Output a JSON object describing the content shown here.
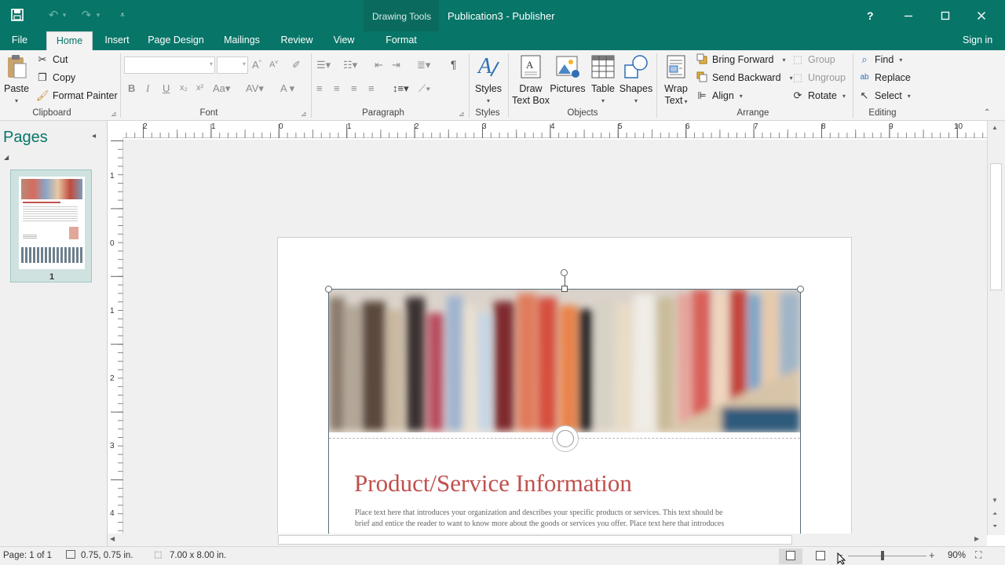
{
  "app": {
    "context_label": "Drawing Tools",
    "title": "Publication3 - Publisher",
    "help": "?",
    "sign_in": "Sign in"
  },
  "tabs": [
    "File",
    "Home",
    "Insert",
    "Page Design",
    "Mailings",
    "Review",
    "View",
    "Format"
  ],
  "active_tab": "Home",
  "ribbon": {
    "clipboard": {
      "paste": "Paste",
      "cut": "Cut",
      "copy": "Copy",
      "format_painter": "Format Painter",
      "label": "Clipboard"
    },
    "font": {
      "label": "Font",
      "font_name": "",
      "font_size": ""
    },
    "paragraph": {
      "label": "Paragraph"
    },
    "styles": {
      "styles": "Styles",
      "label": "Styles"
    },
    "objects": {
      "draw_text_box_1": "Draw",
      "draw_text_box_2": "Text Box",
      "pictures": "Pictures",
      "table": "Table",
      "shapes": "Shapes",
      "label": "Objects"
    },
    "arrange": {
      "wrap_text_1": "Wrap",
      "wrap_text_2": "Text",
      "bring_forward": "Bring Forward",
      "send_backward": "Send Backward",
      "align": "Align",
      "group": "Group",
      "ungroup": "Ungroup",
      "rotate": "Rotate",
      "label": "Arrange"
    },
    "editing": {
      "find": "Find",
      "replace": "Replace",
      "select": "Select",
      "label": "Editing"
    }
  },
  "pages_pane": {
    "title": "Pages",
    "page_number": "1"
  },
  "ruler": {
    "h_labels": [
      "2",
      "1",
      "0",
      "1",
      "2",
      "3",
      "4",
      "5",
      "6",
      "7",
      "8",
      "9",
      "10"
    ],
    "v_labels": [
      "1",
      "0",
      "1",
      "2",
      "3",
      "4"
    ]
  },
  "document": {
    "heading": "Product/Service Information",
    "body_line1": "Place text here that introduces your organization and describes your specific products or services. This text should be",
    "body_line2": "brief and entice the reader to want to know more about the goods or services you offer. Place text here that introduces"
  },
  "status": {
    "page": "Page: 1 of 1",
    "position": "0.75, 0.75 in.",
    "size": "7.00 x 8.00 in.",
    "zoom": "90%"
  },
  "colors": {
    "accent": "#077568",
    "heading": "#c0504d"
  }
}
